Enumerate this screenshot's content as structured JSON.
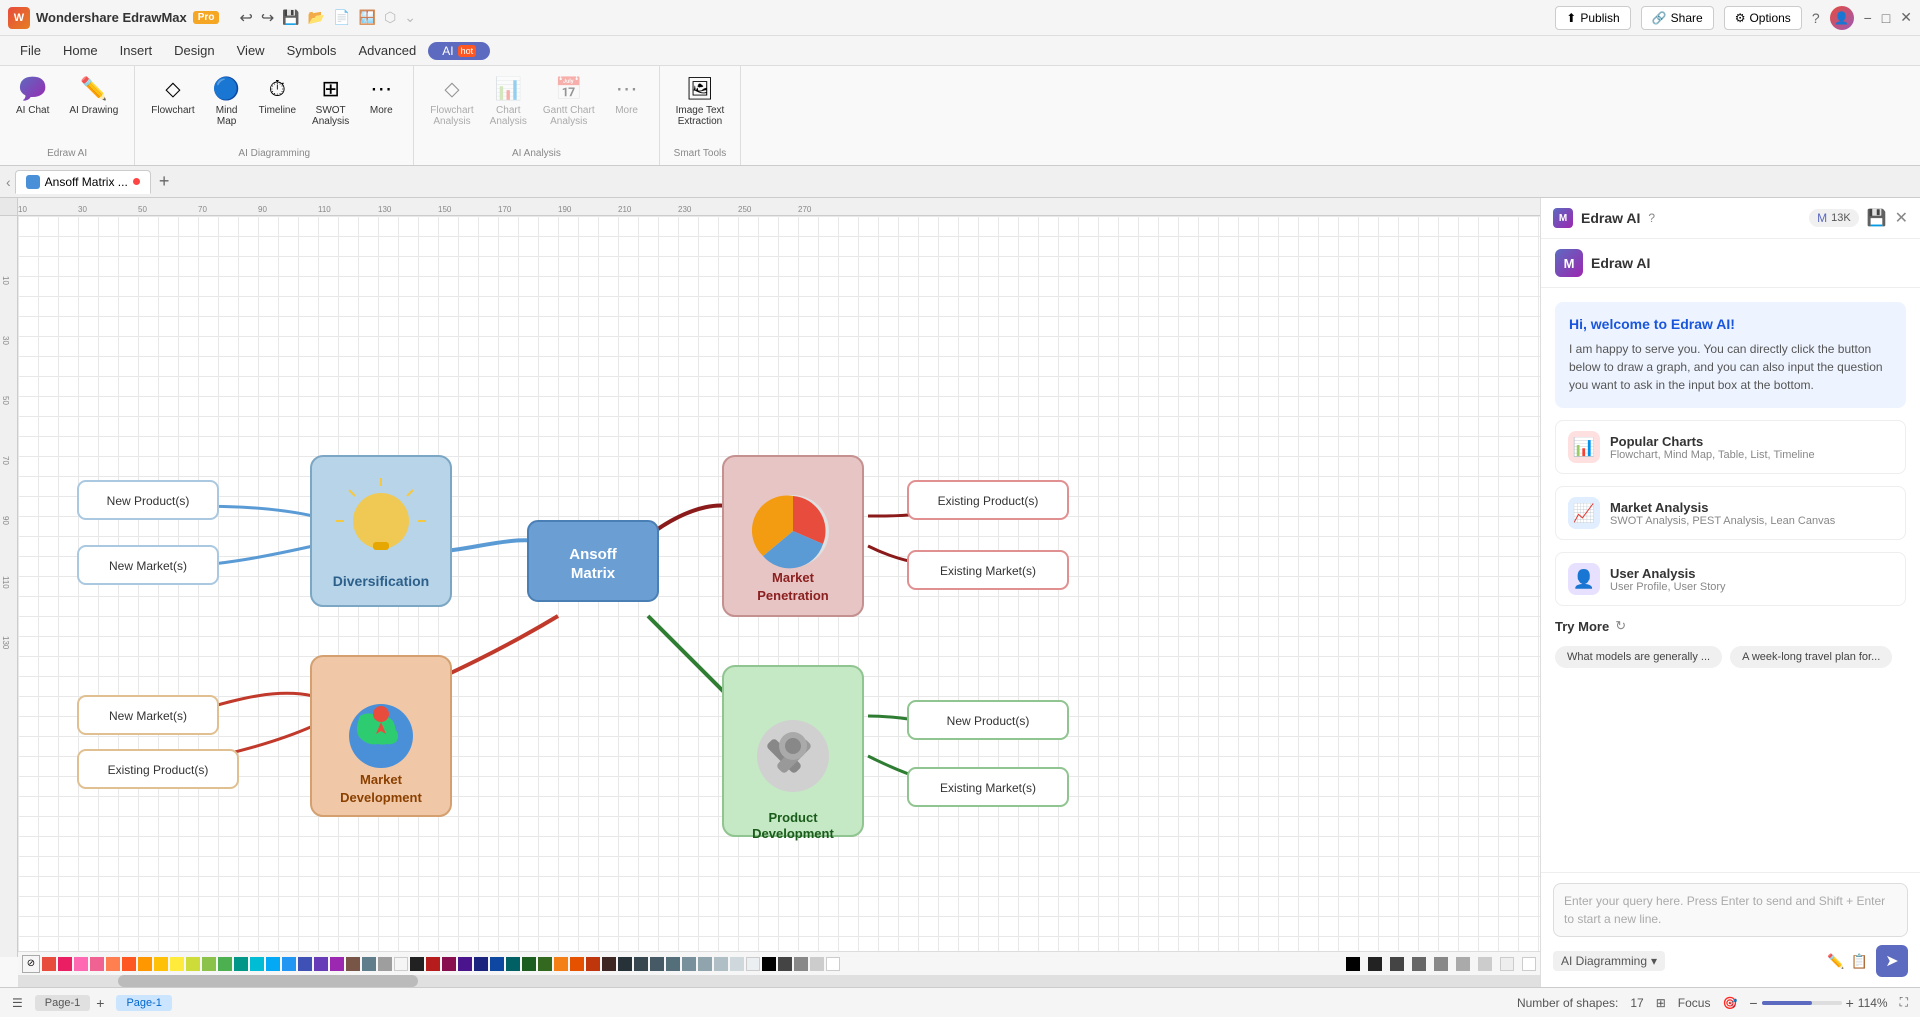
{
  "titlebar": {
    "app_name": "Wondershare EdrawMax",
    "pro_label": "Pro",
    "undo_icon": "↩",
    "redo_icon": "↪",
    "save_icon": "💾",
    "open_icon": "📂",
    "new_icon": "📄",
    "share_icon": "⬡",
    "more_icon": "⌄"
  },
  "menubar": {
    "items": [
      "File",
      "Home",
      "Insert",
      "Design",
      "View",
      "Symbols",
      "Advanced",
      "AI"
    ]
  },
  "ribbon": {
    "edraw_ai": {
      "label": "Edraw AI",
      "ai_chat": "AI Chat",
      "ai_drawing": "AI Drawing"
    },
    "ai_diagramming": {
      "label": "AI Diagramming",
      "items": [
        "Flowchart",
        "Mind Map",
        "Timeline",
        "SWOT Analysis",
        "More"
      ]
    },
    "ai_analysis": {
      "label": "AI Analysis",
      "items": [
        "Flowchart Analysis",
        "Chart Analysis",
        "Gantt Chart Analysis",
        "More"
      ]
    },
    "smart_tools": {
      "label": "Smart Tools",
      "items": [
        "Image Text Extraction"
      ]
    }
  },
  "topright": {
    "publish": "Publish",
    "share": "Share",
    "options": "Options",
    "help": "?",
    "user_avatar": "👤"
  },
  "tabs": {
    "current": "Ansoff Matrix ...",
    "dot_color": "#ff4444",
    "add_label": "+"
  },
  "canvas": {
    "zoom": "114%",
    "shapes_count": "17",
    "shapes_label": "Number of shapes:",
    "page_label": "Page-1"
  },
  "diagram": {
    "center_node": "Ansoff Matrix",
    "nodes": [
      {
        "id": "diversification",
        "label": "Diversification",
        "color_bg": "#b8d4e8",
        "color_border": "#7ba7c4"
      },
      {
        "id": "market_penetration",
        "label": "Market Penetration",
        "color_bg": "#e8c5c5",
        "color_border": "#c49090"
      },
      {
        "id": "market_development",
        "label": "Market Development",
        "color_bg": "#f0c8a8",
        "color_border": "#d4a070"
      },
      {
        "id": "product_development",
        "label": "Product Development",
        "color_bg": "#c5e8c5",
        "color_border": "#90c490"
      }
    ],
    "leaf_nodes": [
      {
        "label": "New Product(s)",
        "group": "diversification_left"
      },
      {
        "label": "New Market(s)",
        "group": "diversification_left"
      },
      {
        "label": "Existing Product(s)",
        "group": "market_penetration_right"
      },
      {
        "label": "Existing Market(s)",
        "group": "market_penetration_right"
      },
      {
        "label": "New Market(s)",
        "group": "market_development_left"
      },
      {
        "label": "Existing Product(s)",
        "group": "market_development_left"
      },
      {
        "label": "New Product(s)",
        "group": "product_development_right"
      },
      {
        "label": "Existing Market(s)",
        "group": "product_development_right"
      }
    ]
  },
  "ai_panel": {
    "title": "Edraw AI",
    "help_icon": "?",
    "token_count": "13K",
    "close_icon": "✕",
    "save_icon": "💾",
    "welcome_title": "Hi, welcome to Edraw AI!",
    "welcome_text": "I am happy to serve you. You can directly click the button below to draw a graph, and you can also input the question you want to ask in the input box at the bottom.",
    "cards": [
      {
        "id": "popular-charts",
        "title": "Popular Charts",
        "subtitle": "Flowchart, Mind Map, Table, List, Timeline",
        "icon": "📊",
        "icon_bg": "#ffe0e0"
      },
      {
        "id": "market-analysis",
        "title": "Market Analysis",
        "subtitle": "SWOT Analysis, PEST Analysis, Lean Canvas",
        "icon": "📈",
        "icon_bg": "#e0eeff"
      },
      {
        "id": "user-analysis",
        "title": "User Analysis",
        "subtitle": "User Profile, User Story",
        "icon": "👤",
        "icon_bg": "#e8e0ff"
      }
    ],
    "try_more_label": "Try More",
    "chips": [
      "What models are generally ...",
      "A week-long travel plan for..."
    ],
    "input_placeholder": "Enter your query here. Press Enter to send and Shift + Enter to start a new line.",
    "input_mode": "AI Diagramming",
    "send_icon": "➤"
  },
  "statusbar": {
    "page_name": "Page-1",
    "add_page": "+",
    "shapes_label": "Number of shapes:",
    "shapes_count": "17",
    "focus_label": "Focus",
    "zoom_level": "114%",
    "zoom_in": "+",
    "zoom_out": "−",
    "fit_icon": "⊞",
    "fullscreen_icon": "⛶"
  },
  "colors": {
    "primary_blue": "#5c6bc0",
    "accent": "#ff5722",
    "brand": "#e67e22"
  }
}
